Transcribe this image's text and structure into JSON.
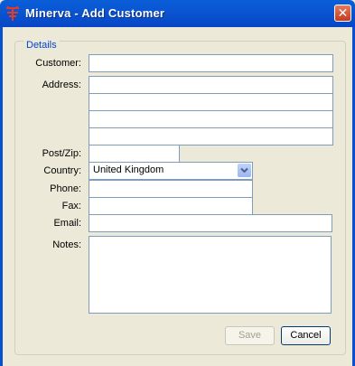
{
  "window": {
    "title": "Minerva - Add Customer",
    "close_glyph": "✕",
    "app_icon": "minerva-logo-icon"
  },
  "group": {
    "title": "Details"
  },
  "labels": {
    "customer": "Customer:",
    "address": "Address:",
    "postzip": "Post/Zip:",
    "country": "Country:",
    "phone": "Phone:",
    "fax": "Fax:",
    "email": "Email:",
    "notes": "Notes:"
  },
  "values": {
    "customer": "",
    "address_lines": [
      "",
      "",
      "",
      ""
    ],
    "postzip": "",
    "country": "United Kingdom",
    "phone": "",
    "fax": "",
    "email": "",
    "notes": ""
  },
  "buttons": {
    "save": "Save",
    "save_enabled": false,
    "cancel": "Cancel"
  },
  "colors": {
    "titlebar": "#0a54d2",
    "group_title": "#0046d5",
    "field_border": "#7f9db9"
  }
}
